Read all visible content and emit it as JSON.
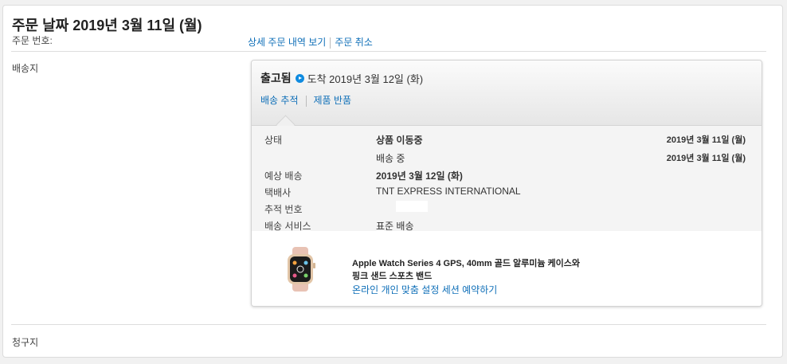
{
  "order": {
    "title": "주문 날짜 2019년 3월 11일 (월)",
    "number_label": "주문 번호:",
    "view_details": "상세 주문 내역 보기",
    "cancel_order": "주문 취소"
  },
  "sections": {
    "shipping": "배송지",
    "billing": "청구지"
  },
  "shipment": {
    "status": "출고됨",
    "arrival": "도착 2019년 3월 12일 (화)",
    "track_link": "배송 추적",
    "return_link": "제품 반품"
  },
  "details": {
    "status_label": "상태",
    "status_1": "상품 이동중",
    "status_1_date": "2019년 3월 11일 (월)",
    "status_2": "배송 중",
    "status_2_date": "2019년 3월 11일 (월)",
    "expected_label": "예상 배송",
    "expected_value": "2019년 3월 12일 (화)",
    "carrier_label": "택배사",
    "carrier_value": "TNT EXPRESS INTERNATIONAL",
    "tracking_label": "추적 번호",
    "service_label": "배송 서비스",
    "service_value": "표준 배송"
  },
  "product": {
    "name_line1": "Apple Watch Series 4 GPS, 40mm 골드 알루미늄 케이스와",
    "name_line2": "핑크 샌드 스포츠 밴드",
    "setup_link": "온라인 개인 맞춤 설정 세션 예약하기"
  },
  "colors": {
    "link": "#0f6fb8",
    "play_icon": "#0f8be0"
  }
}
